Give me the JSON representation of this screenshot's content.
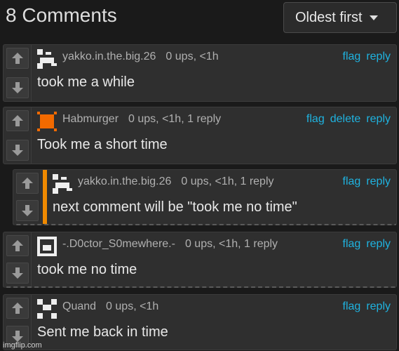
{
  "header": {
    "title": "8 Comments",
    "sort_label": "Oldest first"
  },
  "comments": [
    {
      "user": "yakko.in.the.big.26",
      "meta": "0 ups, <1h",
      "actions": [
        "flag",
        "reply"
      ],
      "text": "took me a while",
      "avatar": "pixel-avatar-white"
    },
    {
      "user": "Habmurger",
      "meta": "0 ups, <1h, 1 reply",
      "actions": [
        "flag",
        "delete",
        "reply"
      ],
      "text": "Took me a short time",
      "avatar": "pixel-avatar-orange"
    },
    {
      "user": "yakko.in.the.big.26",
      "meta": "0 ups, <1h, 1 reply",
      "actions": [
        "flag",
        "reply"
      ],
      "text": "next comment will be \"took me no time\"",
      "avatar": "pixel-avatar-white"
    },
    {
      "user": "-.D0ctor_S0mewhere.-",
      "meta": "0 ups, <1h, 1 reply",
      "actions": [
        "flag",
        "reply"
      ],
      "text": "took me no time",
      "avatar": "pixel-avatar-white-square"
    },
    {
      "user": "Quand",
      "meta": "0 ups, <1h",
      "actions": [
        "flag",
        "reply"
      ],
      "text": "Sent me back in time",
      "avatar": "pixel-avatar-white-face"
    }
  ],
  "watermark": "imgflip.com",
  "colors": {
    "background": "#1a1a1a",
    "card": "#2f2f2f",
    "link": "#1fb3e0",
    "reply_accent": "#f08a00"
  }
}
